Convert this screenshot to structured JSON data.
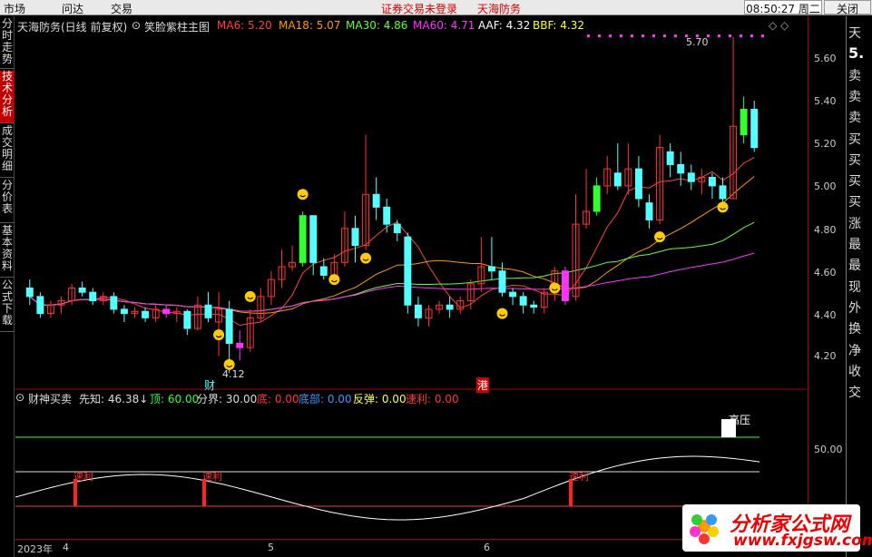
{
  "menubar": {
    "items": [
      "市场",
      "问达",
      "交易"
    ],
    "status_login": "证券交易未登录",
    "status_stock": "天海防务",
    "clock": "08:50:27 周二",
    "close": "关闭"
  },
  "left_tabs": [
    "分时走势",
    "技术分析",
    "成交明细",
    "分价表",
    "基本资料",
    "公式下载"
  ],
  "active_tab": "技术分析",
  "main_panel": {
    "stock_title": "天海防务(日线 前复权)",
    "indicator_name": "笑脸紫柱主图",
    "ma": [
      {
        "label": "MA6: 5.20",
        "color": "#ff4040"
      },
      {
        "label": "MA18: 5.07",
        "color": "#ff9900"
      },
      {
        "label": "MA30: 4.86",
        "color": "#66ff33"
      },
      {
        "label": "MA60: 4.71",
        "color": "#ff33ff"
      },
      {
        "label": "AAF: 4.32",
        "color": "#ffffff"
      },
      {
        "label": "BBF: 4.32",
        "color": "#ffff33"
      }
    ],
    "high_label": "5.70",
    "low_label": "4.12",
    "event_labels": [
      "财",
      "港"
    ],
    "price_ticks": [
      "5.60",
      "5.40",
      "5.20",
      "5.00",
      "4.80",
      "4.60",
      "4.40",
      "4.20"
    ]
  },
  "sub_panel": {
    "name": "财神买卖",
    "values": [
      {
        "label": "先知: 46.38↓",
        "color": "#dddddd"
      },
      {
        "label": "顶: 60.00",
        "color": "#33ff33"
      },
      {
        "label": "分界: 30.00",
        "color": "#dddddd"
      },
      {
        "label": "底: 0.00",
        "color": "#ff3333"
      },
      {
        "label": "底部: 0.00",
        "color": "#3399ff"
      },
      {
        "label": "反弹: 0.00",
        "color": "#ffff33"
      },
      {
        "label": "速利: 0.00",
        "color": "#ff3333"
      }
    ],
    "high_pressure_label": "高压",
    "signal_label": "速利",
    "y_tick": "50.00"
  },
  "date_axis": [
    "2023年",
    "4",
    "5",
    "6"
  ],
  "right_info": [
    "天",
    "5.",
    "卖",
    "卖",
    "卖",
    "买",
    "买",
    "买",
    "买",
    "涨",
    "最",
    "最",
    "现",
    "外",
    "换",
    "净",
    "收",
    "交"
  ],
  "watermark": "分析家公式网 www.fxjgsw.com",
  "logo": {
    "title": "分析家公式网",
    "url": "www.fxjgsw.com"
  },
  "colors": {
    "up": "#ff3333",
    "down": "#54ffff",
    "purple_bar": "#ff33ff",
    "green_bar": "#33ff33",
    "axis": "#aa0000"
  },
  "chart_data": {
    "type": "candlestick",
    "y_range": [
      4.1,
      5.72
    ],
    "candles": [
      [
        4.52,
        4.48,
        4.56,
        4.44
      ],
      [
        4.48,
        4.4,
        4.5,
        4.38
      ],
      [
        4.4,
        4.44,
        4.46,
        4.38
      ],
      [
        4.44,
        4.46,
        4.48,
        4.4
      ],
      [
        4.46,
        4.52,
        4.54,
        4.44
      ],
      [
        4.52,
        4.5,
        4.55,
        4.48
      ],
      [
        4.5,
        4.46,
        4.52,
        4.44
      ],
      [
        4.46,
        4.48,
        4.5,
        4.44
      ],
      [
        4.48,
        4.42,
        4.5,
        4.4
      ],
      [
        4.42,
        4.4,
        4.44,
        4.36
      ],
      [
        4.4,
        4.41,
        4.43,
        4.38
      ],
      [
        4.41,
        4.38,
        4.43,
        4.36
      ],
      [
        4.38,
        4.42,
        4.44,
        4.36
      ],
      [
        4.42,
        4.4,
        4.44,
        4.38
      ],
      [
        4.4,
        4.41,
        4.43,
        4.36
      ],
      [
        4.41,
        4.33,
        4.42,
        4.3
      ],
      [
        4.33,
        4.44,
        4.48,
        4.32
      ],
      [
        4.44,
        4.38,
        4.5,
        4.36
      ],
      [
        4.36,
        4.42,
        4.5,
        4.2
      ],
      [
        4.42,
        4.26,
        4.46,
        4.12
      ],
      [
        4.26,
        4.24,
        4.32,
        4.18
      ],
      [
        4.24,
        4.38,
        4.42,
        4.22
      ],
      [
        4.38,
        4.48,
        4.52,
        4.36
      ],
      [
        4.48,
        4.56,
        4.6,
        4.44
      ],
      [
        4.56,
        4.62,
        4.7,
        4.52
      ],
      [
        4.62,
        4.64,
        4.72,
        4.6
      ],
      [
        4.64,
        4.86,
        4.88,
        4.62
      ],
      [
        4.86,
        4.64,
        4.86,
        4.58
      ],
      [
        4.62,
        4.58,
        4.66,
        4.56
      ],
      [
        4.58,
        4.64,
        4.68,
        4.56
      ],
      [
        4.64,
        4.8,
        4.88,
        4.62
      ],
      [
        4.8,
        4.72,
        4.86,
        4.64
      ],
      [
        4.72,
        4.96,
        5.24,
        4.7
      ],
      [
        4.96,
        4.9,
        5.04,
        4.84
      ],
      [
        4.9,
        4.82,
        4.94,
        4.78
      ],
      [
        4.82,
        4.78,
        4.84,
        4.74
      ],
      [
        4.76,
        4.44,
        4.78,
        4.4
      ],
      [
        4.44,
        4.38,
        4.48,
        4.34
      ],
      [
        4.38,
        4.42,
        4.44,
        4.34
      ],
      [
        4.42,
        4.44,
        4.46,
        4.4
      ],
      [
        4.44,
        4.42,
        4.48,
        4.38
      ],
      [
        4.42,
        4.46,
        4.48,
        4.4
      ],
      [
        4.46,
        4.54,
        4.56,
        4.42
      ],
      [
        4.54,
        4.62,
        4.76,
        4.5
      ],
      [
        4.62,
        4.6,
        4.76,
        4.56
      ],
      [
        4.6,
        4.5,
        4.64,
        4.48
      ],
      [
        4.5,
        4.48,
        4.52,
        4.44
      ],
      [
        4.48,
        4.44,
        4.5,
        4.4
      ],
      [
        4.44,
        4.43,
        4.46,
        4.4
      ],
      [
        4.43,
        4.5,
        4.52,
        4.4
      ],
      [
        4.5,
        4.6,
        4.62,
        4.46
      ],
      [
        4.6,
        4.46,
        4.62,
        4.44
      ],
      [
        4.48,
        4.82,
        4.96,
        4.46
      ],
      [
        4.82,
        4.88,
        5.08,
        4.8
      ],
      [
        4.88,
        5.0,
        5.04,
        4.86
      ],
      [
        5.0,
        5.08,
        5.14,
        4.96
      ],
      [
        5.06,
        5.0,
        5.2,
        4.98
      ],
      [
        5.0,
        5.08,
        5.2,
        4.96
      ],
      [
        5.08,
        4.94,
        5.14,
        4.9
      ],
      [
        4.92,
        4.84,
        4.96,
        4.8
      ],
      [
        4.84,
        5.18,
        5.24,
        4.82
      ],
      [
        5.16,
        5.1,
        5.2,
        5.04
      ],
      [
        5.1,
        5.06,
        5.16,
        5.0
      ],
      [
        5.06,
        5.02,
        5.1,
        4.98
      ],
      [
        5.02,
        5.04,
        5.08,
        4.96
      ],
      [
        5.04,
        5.0,
        5.06,
        4.94
      ],
      [
        5.0,
        4.94,
        5.04,
        4.9
      ],
      [
        4.94,
        5.28,
        5.7,
        4.94
      ],
      [
        5.24,
        5.36,
        5.42,
        5.2
      ],
      [
        5.36,
        5.18,
        5.4,
        5.16
      ]
    ],
    "purple_bars_index": [
      13,
      20,
      51
    ],
    "green_bars_index": [
      26,
      54,
      68
    ]
  }
}
